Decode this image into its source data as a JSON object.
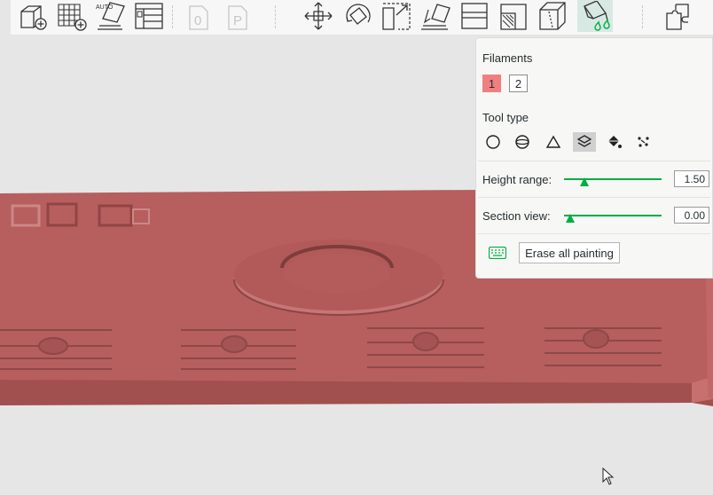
{
  "toolbar": {
    "buttons": [
      {
        "name": "add-object-button",
        "icon": "cube-plus-icon",
        "active": false
      },
      {
        "name": "add-plate-button",
        "icon": "grid-plus-icon",
        "active": false
      },
      {
        "name": "auto-orient-button",
        "icon": "auto-orient-icon",
        "label": "AUTO",
        "active": false
      },
      {
        "name": "arrange-button",
        "icon": "arrange-layout-icon",
        "active": false
      },
      {
        "name": "plate-0-button",
        "icon": "plate-zero-icon",
        "label": "0",
        "active": false,
        "disabled": true
      },
      {
        "name": "plate-p-button",
        "icon": "plate-p-icon",
        "label": "P",
        "active": false,
        "disabled": true
      },
      {
        "name": "move-button",
        "icon": "move-arrows-icon",
        "active": false
      },
      {
        "name": "rotate-button",
        "icon": "rotate-icon",
        "active": false
      },
      {
        "name": "scale-button",
        "icon": "scale-icon",
        "active": false
      },
      {
        "name": "lay-on-face-button",
        "icon": "lay-on-face-icon",
        "active": false
      },
      {
        "name": "cut-button",
        "icon": "cut-icon",
        "active": false
      },
      {
        "name": "support-paint-button",
        "icon": "support-paint-icon",
        "active": false
      },
      {
        "name": "seam-paint-button",
        "icon": "seam-paint-icon",
        "active": false
      },
      {
        "name": "color-paint-button",
        "icon": "color-paint-icon",
        "active": true
      },
      {
        "name": "assembly-button",
        "icon": "puzzle-icon",
        "active": false
      }
    ]
  },
  "paint_panel": {
    "filaments_label": "Filaments",
    "filaments": [
      {
        "label": "1",
        "color": "#f08080",
        "selected": true
      },
      {
        "label": "2",
        "color": "#ffffff",
        "selected": false
      }
    ],
    "tool_type_label": "Tool type",
    "tools": [
      {
        "name": "circle-tool",
        "icon": "circle-icon",
        "selected": false
      },
      {
        "name": "sphere-tool",
        "icon": "sphere-icon",
        "selected": false
      },
      {
        "name": "triangle-tool",
        "icon": "triangle-icon",
        "selected": false
      },
      {
        "name": "height-range-tool",
        "icon": "layers-icon",
        "selected": true
      },
      {
        "name": "fill-tool",
        "icon": "fill-bucket-icon",
        "selected": false
      },
      {
        "name": "gap-fill-tool",
        "icon": "gap-fill-icon",
        "selected": false
      }
    ],
    "height_range": {
      "label": "Height range:",
      "value": "1.50",
      "fraction": 0.2
    },
    "section_view": {
      "label": "Section view:",
      "value": "0.00",
      "fraction": 0.0
    },
    "shortcut_icon": "keyboard-icon",
    "erase_label": "Erase all painting"
  },
  "colors": {
    "accent": "#00ae42",
    "plate": "#b75e5e",
    "background": "#e6e6e6"
  }
}
